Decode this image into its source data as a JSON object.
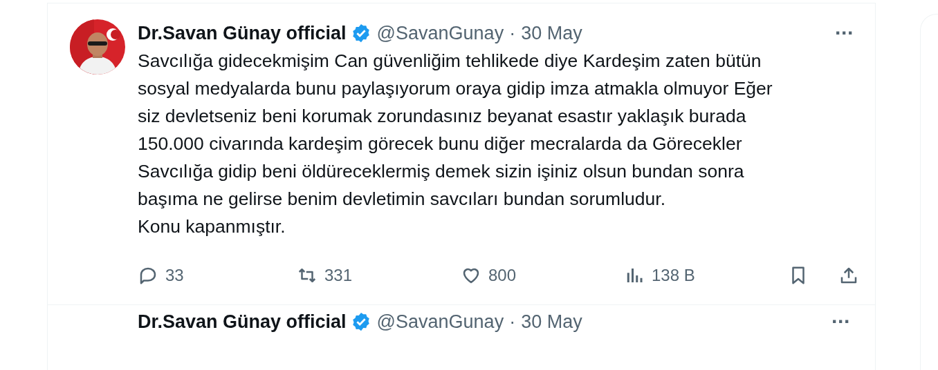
{
  "tweets": [
    {
      "author": "Dr.Savan Günay official",
      "verified": true,
      "handle": "@SavanGunay",
      "separator": "·",
      "date": "30 May",
      "more": "···",
      "paragraphs": [
        "Savcılığa gidecekmişim Can güvenliğim tehlikede diye Kardeşim zaten bütün sosyal medyalarda bunu paylaşıyorum oraya gidip imza atmakla olmuyor Eğer siz devletseniz beni korumak zorundasınız beyanat esastır yaklaşık burada 150.000 civarında kardeşim görecek bunu diğer mecralarda da Görecekler",
        "Savcılığa gidip beni öldüreceklermiş demek sizin işiniz olsun bundan sonra başıma ne gelirse benim devletimin savcıları bundan sorumludur.",
        "Konu kapanmıştır."
      ],
      "actions": [
        {
          "kind": "reply",
          "count": "33"
        },
        {
          "kind": "repost",
          "count": "331"
        },
        {
          "kind": "like",
          "count": "800"
        },
        {
          "kind": "views",
          "count": "138 B"
        },
        {
          "kind": "bookmark"
        },
        {
          "kind": "share"
        }
      ]
    },
    {
      "author": "Dr.Savan Günay official",
      "verified": true,
      "handle": "@SavanGunay",
      "separator": "·",
      "date": "30 May",
      "more": "···"
    }
  ]
}
